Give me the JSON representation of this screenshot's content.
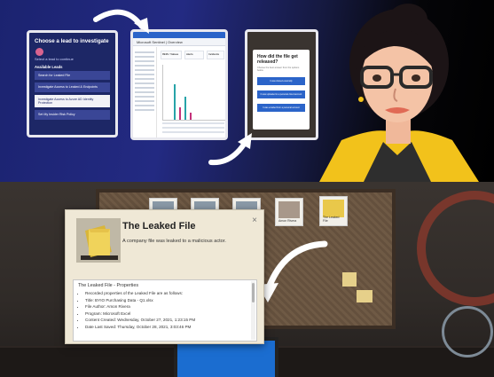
{
  "panel1": {
    "title": "Choose a lead to investigate",
    "subtitle": "Select a lead to continue",
    "leads_label": "Available Leads",
    "leads": [
      "Search for Leaked File",
      "Investigate Access to Leaked & Endpoints",
      "Investigate Access to Azure AD Identity Protection",
      "Set My Insider Risk Policy"
    ]
  },
  "panel2": {
    "header": "Microsoft Sentinel | Overview",
    "card1": "9946 / Values",
    "card2": "Alerts",
    "card3": "Incidents"
  },
  "panel3": {
    "question": "How did the file get released?",
    "hint": "Choose the best answer from the options below",
    "options": [
      "It was shared externally",
      "It was uploaded to a personal cloud account",
      "It was emailed from a personal account"
    ]
  },
  "dialog": {
    "title": "The Leaked File",
    "description": "A company file was leaked to a malicious actor.",
    "close_glyph": "×",
    "properties_title": "The Leaked File - Properties",
    "properties": [
      "Recorded properties of the Leaked File are as follows:",
      "Title: BYIO Purchasing Data - Q1.xlsx",
      "File Author: Amon Rivera",
      "Program: Microsoft Excel",
      "Content Created: Wednesday, October 27, 2021, 1:23:15 PM",
      "Date Last Saved: Thursday, October 28, 2021, 3:03:46 PM"
    ]
  },
  "board": {
    "photo_labels": [
      "Amon Rivera",
      "The Leaked File"
    ]
  },
  "colors": {
    "banner_blue": "#232a82",
    "button_blue": "#2b64c9",
    "folder_yellow": "#e9c84a",
    "dialog_bg": "#efe8d6",
    "jacket_yellow": "#f2c21b"
  }
}
